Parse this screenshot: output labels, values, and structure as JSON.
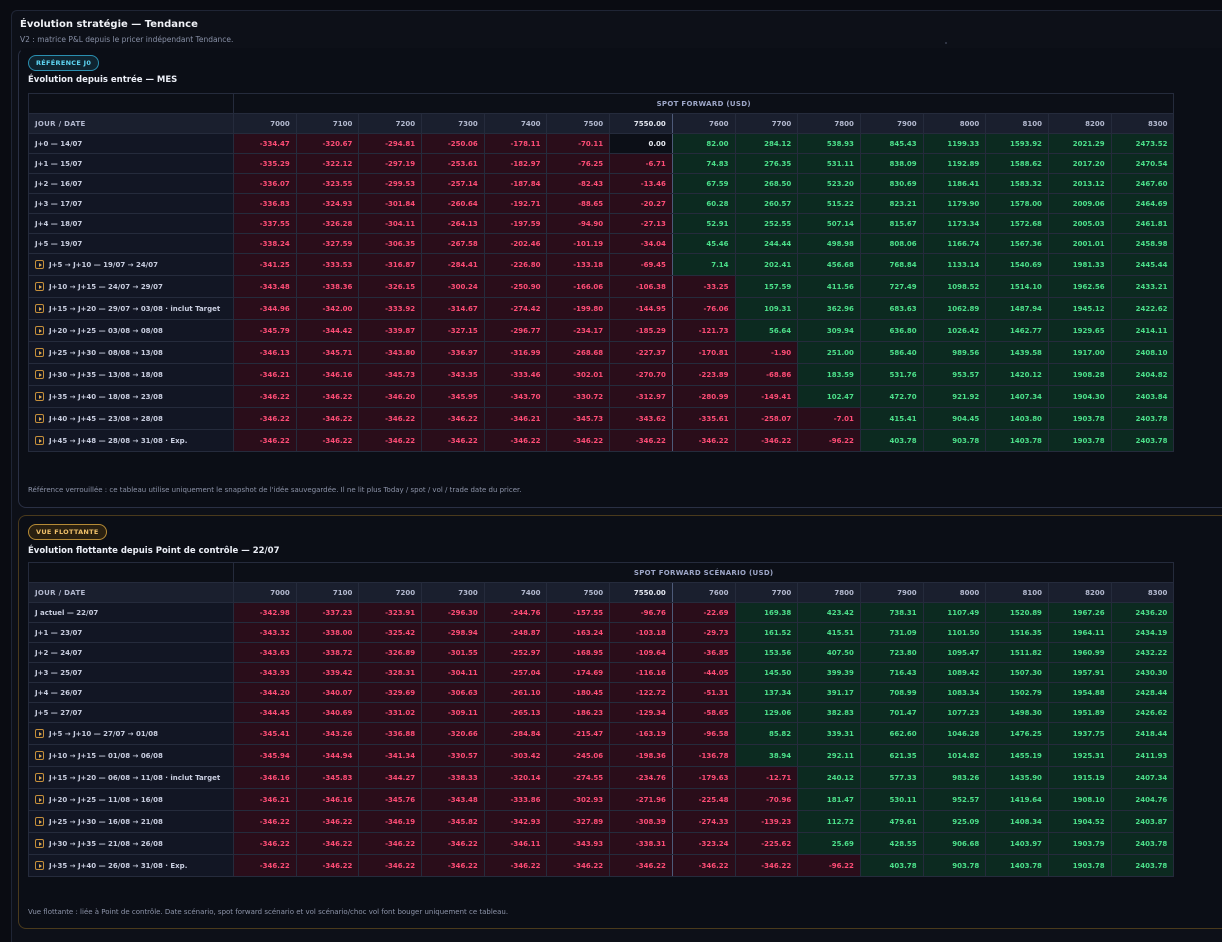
{
  "window": {
    "title": "Évolution stratégie — Tendance",
    "subtitle": "V2 : matrice P&L depuis le pricer indépendant Tendance."
  },
  "panel1": {
    "badge": "RÉFÉRENCE J0",
    "title": "Évolution depuis entrée — MES",
    "super_header": "SPOT FORWARD (USD)",
    "first_col_header": "JOUR / DATE",
    "columns": [
      "7000",
      "7100",
      "7200",
      "7300",
      "7400",
      "7500",
      "7550.00",
      "7600",
      "7700",
      "7800",
      "7900",
      "8000",
      "8100",
      "8200",
      "8300"
    ],
    "ref_index": 6,
    "rows": [
      {
        "label": "J+0 — 14/07",
        "range": false,
        "values": [
          "-334.47",
          "-320.67",
          "-294.81",
          "-250.06",
          "-178.11",
          "-70.11",
          "0.00",
          "82.00",
          "284.12",
          "538.93",
          "845.43",
          "1199.33",
          "1593.92",
          "2021.29",
          "2473.52"
        ]
      },
      {
        "label": "J+1 — 15/07",
        "range": false,
        "values": [
          "-335.29",
          "-322.12",
          "-297.19",
          "-253.61",
          "-182.97",
          "-76.25",
          "-6.71",
          "74.83",
          "276.35",
          "531.11",
          "838.09",
          "1192.89",
          "1588.62",
          "2017.20",
          "2470.54"
        ]
      },
      {
        "label": "J+2 — 16/07",
        "range": false,
        "values": [
          "-336.07",
          "-323.55",
          "-299.53",
          "-257.14",
          "-187.84",
          "-82.43",
          "-13.46",
          "67.59",
          "268.50",
          "523.20",
          "830.69",
          "1186.41",
          "1583.32",
          "2013.12",
          "2467.60"
        ]
      },
      {
        "label": "J+3 — 17/07",
        "range": false,
        "values": [
          "-336.83",
          "-324.93",
          "-301.84",
          "-260.64",
          "-192.71",
          "-88.65",
          "-20.27",
          "60.28",
          "260.57",
          "515.22",
          "823.21",
          "1179.90",
          "1578.00",
          "2009.06",
          "2464.69"
        ]
      },
      {
        "label": "J+4 — 18/07",
        "range": false,
        "values": [
          "-337.55",
          "-326.28",
          "-304.11",
          "-264.13",
          "-197.59",
          "-94.90",
          "-27.13",
          "52.91",
          "252.55",
          "507.14",
          "815.67",
          "1173.34",
          "1572.68",
          "2005.03",
          "2461.81"
        ]
      },
      {
        "label": "J+5 — 19/07",
        "range": false,
        "values": [
          "-338.24",
          "-327.59",
          "-306.35",
          "-267.58",
          "-202.46",
          "-101.19",
          "-34.04",
          "45.46",
          "244.44",
          "498.98",
          "808.06",
          "1166.74",
          "1567.36",
          "2001.01",
          "2458.98"
        ]
      },
      {
        "label": "J+5 → J+10 — 19/07 → 24/07",
        "range": true,
        "values": [
          "-341.25",
          "-333.53",
          "-316.87",
          "-284.41",
          "-226.80",
          "-133.18",
          "-69.45",
          "7.14",
          "202.41",
          "456.68",
          "768.84",
          "1133.14",
          "1540.69",
          "1981.33",
          "2445.44"
        ]
      },
      {
        "label": "J+10 → J+15 — 24/07 → 29/07",
        "range": true,
        "values": [
          "-343.48",
          "-338.36",
          "-326.15",
          "-300.24",
          "-250.90",
          "-166.06",
          "-106.38",
          "-33.25",
          "157.59",
          "411.56",
          "727.49",
          "1098.52",
          "1514.10",
          "1962.56",
          "2433.21"
        ]
      },
      {
        "label": "J+15 → J+20 — 29/07 → 03/08 · inclut Target",
        "range": true,
        "values": [
          "-344.96",
          "-342.00",
          "-333.92",
          "-314.67",
          "-274.42",
          "-199.80",
          "-144.95",
          "-76.06",
          "109.31",
          "362.96",
          "683.63",
          "1062.89",
          "1487.94",
          "1945.12",
          "2422.62"
        ]
      },
      {
        "label": "J+20 → J+25 — 03/08 → 08/08",
        "range": true,
        "values": [
          "-345.79",
          "-344.42",
          "-339.87",
          "-327.15",
          "-296.77",
          "-234.17",
          "-185.29",
          "-121.73",
          "56.64",
          "309.94",
          "636.80",
          "1026.42",
          "1462.77",
          "1929.65",
          "2414.11"
        ]
      },
      {
        "label": "J+25 → J+30 — 08/08 → 13/08",
        "range": true,
        "values": [
          "-346.13",
          "-345.71",
          "-343.80",
          "-336.97",
          "-316.99",
          "-268.68",
          "-227.37",
          "-170.81",
          "-1.90",
          "251.00",
          "586.40",
          "989.56",
          "1439.58",
          "1917.00",
          "2408.10"
        ]
      },
      {
        "label": "J+30 → J+35 — 13/08 → 18/08",
        "range": true,
        "values": [
          "-346.21",
          "-346.16",
          "-345.73",
          "-343.35",
          "-333.46",
          "-302.01",
          "-270.70",
          "-223.89",
          "-68.86",
          "183.59",
          "531.76",
          "953.57",
          "1420.12",
          "1908.28",
          "2404.82"
        ]
      },
      {
        "label": "J+35 → J+40 — 18/08 → 23/08",
        "range": true,
        "values": [
          "-346.22",
          "-346.22",
          "-346.20",
          "-345.95",
          "-343.70",
          "-330.72",
          "-312.97",
          "-280.99",
          "-149.41",
          "102.47",
          "472.70",
          "921.92",
          "1407.34",
          "1904.30",
          "2403.84"
        ]
      },
      {
        "label": "J+40 → J+45 — 23/08 → 28/08",
        "range": true,
        "values": [
          "-346.22",
          "-346.22",
          "-346.22",
          "-346.22",
          "-346.21",
          "-345.73",
          "-343.62",
          "-335.61",
          "-258.07",
          "-7.01",
          "415.41",
          "904.45",
          "1403.80",
          "1903.78",
          "2403.78"
        ]
      },
      {
        "label": "J+45 → J+48 — 28/08 → 31/08 · Exp.",
        "range": true,
        "values": [
          "-346.22",
          "-346.22",
          "-346.22",
          "-346.22",
          "-346.22",
          "-346.22",
          "-346.22",
          "-346.22",
          "-346.22",
          "-96.22",
          "403.78",
          "903.78",
          "1403.78",
          "1903.78",
          "2403.78"
        ]
      }
    ],
    "note": "Référence verrouillée : ce tableau utilise uniquement le snapshot de l'idée sauvegardée. Il ne lit plus Today / spot / vol / trade date du pricer."
  },
  "panel2": {
    "badge": "VUE FLOTTANTE",
    "title": "Évolution flottante depuis Point de contrôle — 22/07",
    "super_header": "SPOT FORWARD SCÉNARIO (USD)",
    "first_col_header": "JOUR / DATE",
    "columns": [
      "7000",
      "7100",
      "7200",
      "7300",
      "7400",
      "7500",
      "7550.00",
      "7600",
      "7700",
      "7800",
      "7900",
      "8000",
      "8100",
      "8200",
      "8300"
    ],
    "ref_index": 6,
    "rows": [
      {
        "label": "J actuel — 22/07",
        "range": false,
        "values": [
          "-342.98",
          "-337.23",
          "-323.91",
          "-296.30",
          "-244.76",
          "-157.55",
          "-96.76",
          "-22.69",
          "169.38",
          "423.42",
          "738.31",
          "1107.49",
          "1520.89",
          "1967.26",
          "2436.20"
        ]
      },
      {
        "label": "J+1 — 23/07",
        "range": false,
        "values": [
          "-343.32",
          "-338.00",
          "-325.42",
          "-298.94",
          "-248.87",
          "-163.24",
          "-103.18",
          "-29.73",
          "161.52",
          "415.51",
          "731.09",
          "1101.50",
          "1516.35",
          "1964.11",
          "2434.19"
        ]
      },
      {
        "label": "J+2 — 24/07",
        "range": false,
        "values": [
          "-343.63",
          "-338.72",
          "-326.89",
          "-301.55",
          "-252.97",
          "-168.95",
          "-109.64",
          "-36.85",
          "153.56",
          "407.50",
          "723.80",
          "1095.47",
          "1511.82",
          "1960.99",
          "2432.22"
        ]
      },
      {
        "label": "J+3 — 25/07",
        "range": false,
        "values": [
          "-343.93",
          "-339.42",
          "-328.31",
          "-304.11",
          "-257.04",
          "-174.69",
          "-116.16",
          "-44.05",
          "145.50",
          "399.39",
          "716.43",
          "1089.42",
          "1507.30",
          "1957.91",
          "2430.30"
        ]
      },
      {
        "label": "J+4 — 26/07",
        "range": false,
        "values": [
          "-344.20",
          "-340.07",
          "-329.69",
          "-306.63",
          "-261.10",
          "-180.45",
          "-122.72",
          "-51.31",
          "137.34",
          "391.17",
          "708.99",
          "1083.34",
          "1502.79",
          "1954.88",
          "2428.44"
        ]
      },
      {
        "label": "J+5 — 27/07",
        "range": false,
        "values": [
          "-344.45",
          "-340.69",
          "-331.02",
          "-309.11",
          "-265.13",
          "-186.23",
          "-129.34",
          "-58.65",
          "129.06",
          "382.83",
          "701.47",
          "1077.23",
          "1498.30",
          "1951.89",
          "2426.62"
        ]
      },
      {
        "label": "J+5 → J+10 — 27/07 → 01/08",
        "range": true,
        "values": [
          "-345.41",
          "-343.26",
          "-336.88",
          "-320.66",
          "-284.84",
          "-215.47",
          "-163.19",
          "-96.58",
          "85.82",
          "339.31",
          "662.60",
          "1046.28",
          "1476.25",
          "1937.75",
          "2418.44"
        ]
      },
      {
        "label": "J+10 → J+15 — 01/08 → 06/08",
        "range": true,
        "values": [
          "-345.94",
          "-344.94",
          "-341.34",
          "-330.57",
          "-303.42",
          "-245.06",
          "-198.36",
          "-136.78",
          "38.94",
          "292.11",
          "621.35",
          "1014.82",
          "1455.19",
          "1925.31",
          "2411.93"
        ]
      },
      {
        "label": "J+15 → J+20 — 06/08 → 11/08 · inclut Target",
        "range": true,
        "values": [
          "-346.16",
          "-345.83",
          "-344.27",
          "-338.33",
          "-320.14",
          "-274.55",
          "-234.76",
          "-179.63",
          "-12.71",
          "240.12",
          "577.33",
          "983.26",
          "1435.90",
          "1915.19",
          "2407.34"
        ]
      },
      {
        "label": "J+20 → J+25 — 11/08 → 16/08",
        "range": true,
        "values": [
          "-346.21",
          "-346.16",
          "-345.76",
          "-343.48",
          "-333.86",
          "-302.93",
          "-271.96",
          "-225.48",
          "-70.96",
          "181.47",
          "530.11",
          "952.57",
          "1419.64",
          "1908.10",
          "2404.76"
        ]
      },
      {
        "label": "J+25 → J+30 — 16/08 → 21/08",
        "range": true,
        "values": [
          "-346.22",
          "-346.22",
          "-346.19",
          "-345.82",
          "-342.93",
          "-327.89",
          "-308.39",
          "-274.33",
          "-139.23",
          "112.72",
          "479.61",
          "925.09",
          "1408.34",
          "1904.52",
          "2403.87"
        ]
      },
      {
        "label": "J+30 → J+35 — 21/08 → 26/08",
        "range": true,
        "values": [
          "-346.22",
          "-346.22",
          "-346.22",
          "-346.22",
          "-346.11",
          "-343.93",
          "-338.31",
          "-323.24",
          "-225.62",
          "25.69",
          "428.55",
          "906.68",
          "1403.97",
          "1903.79",
          "2403.78"
        ]
      },
      {
        "label": "J+35 → J+40 — 26/08 → 31/08 · Exp.",
        "range": true,
        "values": [
          "-346.22",
          "-346.22",
          "-346.22",
          "-346.22",
          "-346.22",
          "-346.22",
          "-346.22",
          "-346.22",
          "-346.22",
          "-96.22",
          "403.78",
          "903.78",
          "1403.78",
          "1903.78",
          "2403.78"
        ]
      }
    ],
    "note": "Vue flottante : liée à Point de contrôle. Date scénario, spot forward scénario et vol scénario/choc vol font bouger uniquement ce tableau."
  },
  "colors": {
    "negative_text": "#ff4d76",
    "negative_bg": "#2a0d1a",
    "positive_text": "#4ce08a",
    "positive_bg": "#0c2a20",
    "badge_reference": "#5fd7f5",
    "badge_floating": "#f0c06a"
  },
  "icons": {
    "range_row_marker": "play-icon"
  }
}
